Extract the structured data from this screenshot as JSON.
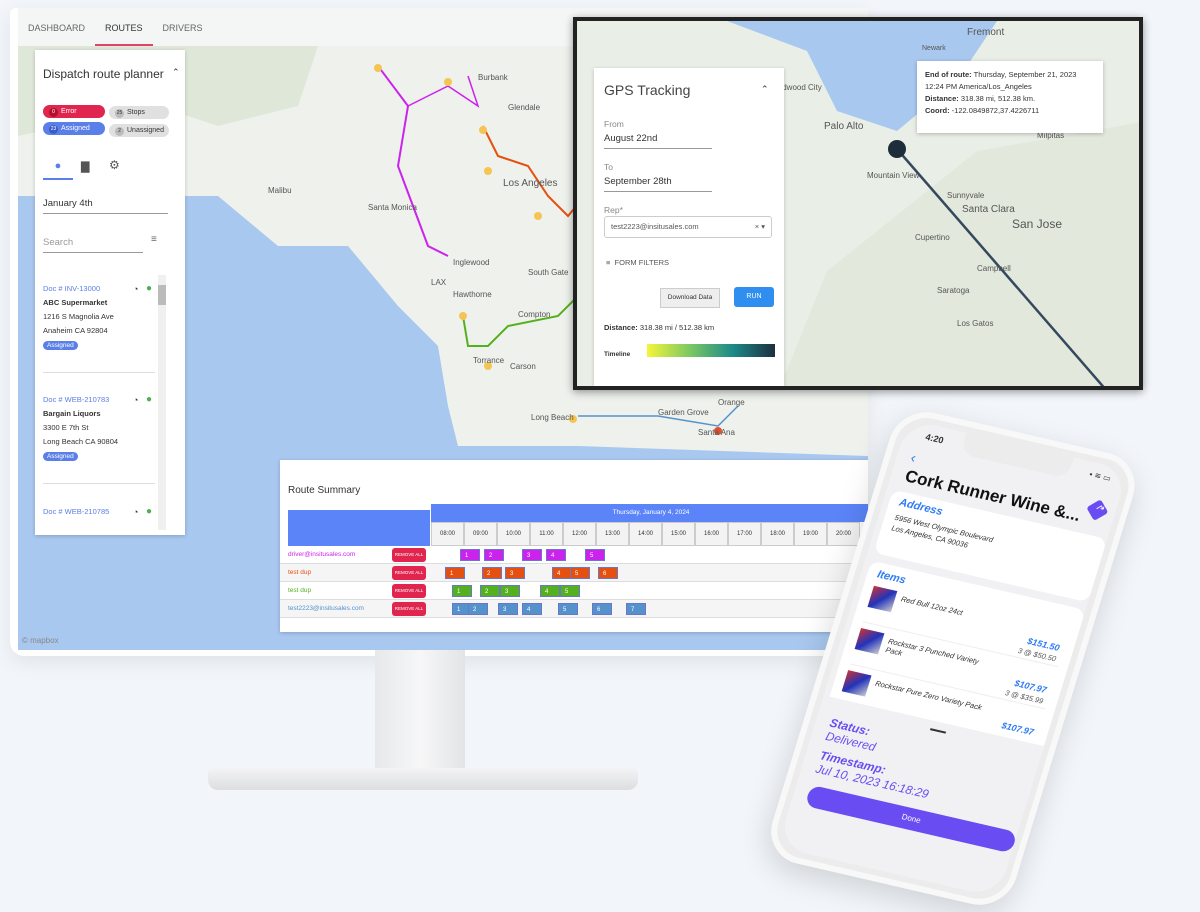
{
  "colors": {
    "accent": "#5a7fe8",
    "error": "#e0264e",
    "purple_route": "#cc22ee",
    "orange_route": "#e55010",
    "green_route": "#55b020",
    "blue_route": "#5592cc",
    "done": "#6a4df2"
  },
  "tabs": [
    {
      "label": "DASHBOARD"
    },
    {
      "label": "ROUTES"
    },
    {
      "label": "DRIVERS"
    }
  ],
  "sidebar": {
    "title": "Dispatch route planner",
    "chips": {
      "error": {
        "count": "0",
        "label": "Error"
      },
      "stops": {
        "count": "25",
        "label": "Stops"
      },
      "assigned": {
        "count": "23",
        "label": "Assigned"
      },
      "unassigned": {
        "count": "2",
        "label": "Unassigned"
      }
    },
    "icons": [
      "map-pin-icon",
      "truck-icon",
      "gear-icon"
    ],
    "date": "January 4th",
    "search_placeholder": "Search",
    "cards": [
      {
        "doc": "Doc # INV-13000",
        "name": "ABC Supermarket",
        "addr1": "1216 S Magnolia Ave",
        "addr2": "Anaheim CA 92804",
        "status": "Assigned"
      },
      {
        "doc": "Doc # WEB-210783",
        "name": "Bargain Liquors",
        "addr1": "3300 E 7th St",
        "addr2": "Long Beach CA 90804",
        "status": "Assigned"
      },
      {
        "doc": "Doc # WEB-210785"
      }
    ]
  },
  "map_labels": [
    "Burbank",
    "Glendale",
    "Los Angeles",
    "Santa Monica",
    "Inglewood",
    "South Gate",
    "Hawthorne",
    "Compton",
    "Torrance",
    "Carson",
    "Long Beach",
    "Garden Grove",
    "Santa Ana",
    "Malibu",
    "Orange",
    "LAX"
  ],
  "map_attribution": "© mapbox",
  "summary": {
    "title": "Route Summary",
    "date": "Thursday, January 4, 2024",
    "hours": [
      "08:00",
      "09:00",
      "10:00",
      "11:00",
      "12:00",
      "13:00",
      "14:00",
      "15:00",
      "16:00",
      "17:00",
      "18:00",
      "19:00",
      "20:00"
    ],
    "remove_label": "REMOVE ALL",
    "rows": [
      {
        "driver": "driver@insitusales.com",
        "color": "#cc22ee",
        "stops": [
          "1",
          "2",
          "3",
          "4",
          "5"
        ]
      },
      {
        "driver": "test dup",
        "color": "#e55010",
        "stops": [
          "1",
          "2",
          "3",
          "4",
          "5",
          "6"
        ]
      },
      {
        "driver": "test dup",
        "color": "#55b020",
        "stops": [
          "1",
          "2",
          "3",
          "4",
          "5"
        ]
      },
      {
        "driver": "test2223@insitusales.com",
        "color": "#5592cc",
        "stops": [
          "1",
          "2",
          "3",
          "4",
          "5",
          "6",
          "7"
        ]
      }
    ]
  },
  "gps": {
    "title": "GPS Tracking",
    "from_label": "From",
    "from": "August 22nd",
    "to_label": "To",
    "to": "September 28th",
    "rep_label": "Rep*",
    "rep": "test2223@insitusales.com",
    "filters": "FORM FILTERS",
    "download": "Download Data",
    "run": "RUN",
    "distance_label": "Distance:",
    "distance": "318.38 mi / 512.38 km",
    "timeline": "Timeline",
    "popup": {
      "end_label": "End of route:",
      "end": "Thursday, September 21, 2023 12:24 PM America/Los_Angeles",
      "dist_label": "Distance:",
      "dist": "318.38 mi, 512.38 km.",
      "coord_label": "Coord:",
      "coord": "-122.0849872,37.4226711"
    },
    "map_labels": [
      "Fremont",
      "Newark",
      "Palo Alto",
      "Mountain View",
      "Sunnyvale",
      "Santa Clara",
      "San Jose",
      "Cupertino",
      "Saratoga",
      "Los Gatos",
      "Campbell",
      "Milpitas",
      "Redwood City"
    ]
  },
  "phone": {
    "time": "4:20",
    "title": "Cork Runner Wine &...",
    "address_label": "Address",
    "addr1": "5956 West Olympic Boulevard",
    "addr2": "Los Angeles, CA  90036",
    "items_label": "Items",
    "items": [
      {
        "name": "Red Bull 12oz 24ct",
        "total": "$151.50",
        "qty": "3 @ $50.50"
      },
      {
        "name": "Rockstar 3 Punched Variety Pack",
        "total": "$107.97",
        "qty": "3 @ $35.99"
      },
      {
        "name": "Rockstar Pure Zero Variety Pack",
        "total": "$107.97"
      }
    ],
    "status_label": "Status:",
    "status": "Delivered",
    "timestamp_label": "Timestamp:",
    "timestamp": "Jul 10, 2023 16:18:29",
    "done": "Done"
  }
}
